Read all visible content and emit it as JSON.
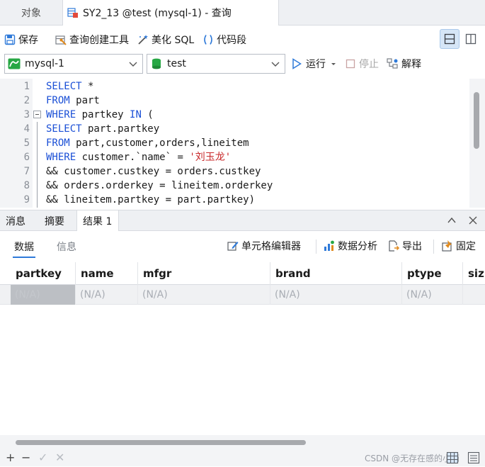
{
  "tabs": {
    "objects": "对象",
    "query": "SY2_13 @test (mysql-1) - 查询"
  },
  "toolbar": {
    "save": "保存",
    "query_builder": "查询创建工具",
    "beautify": "美化 SQL",
    "snippet": "代码段"
  },
  "connection": {
    "conn_value": "mysql-1",
    "db_value": "test",
    "run": "运行",
    "stop": "停止",
    "explain": "解释"
  },
  "editor": {
    "lines": [
      {
        "n": "1",
        "parts": [
          {
            "t": "SELECT",
            "c": "kw"
          },
          {
            "t": " *",
            "c": ""
          }
        ]
      },
      {
        "n": "2",
        "parts": [
          {
            "t": "FROM",
            "c": "kw"
          },
          {
            "t": " part",
            "c": ""
          }
        ]
      },
      {
        "n": "3",
        "parts": [
          {
            "t": "WHERE",
            "c": "kw"
          },
          {
            "t": " partkey ",
            "c": ""
          },
          {
            "t": "IN",
            "c": "kw"
          },
          {
            "t": " (",
            "c": ""
          }
        ]
      },
      {
        "n": "4",
        "parts": [
          {
            "t": "SELECT",
            "c": "kw"
          },
          {
            "t": " part.partkey",
            "c": ""
          }
        ]
      },
      {
        "n": "5",
        "parts": [
          {
            "t": "FROM",
            "c": "kw"
          },
          {
            "t": " part,customer,orders,lineitem",
            "c": ""
          }
        ]
      },
      {
        "n": "6",
        "parts": [
          {
            "t": "WHERE",
            "c": "kw"
          },
          {
            "t": " customer.`name` = ",
            "c": ""
          },
          {
            "t": "'刘玉龙'",
            "c": "str"
          }
        ]
      },
      {
        "n": "7",
        "parts": [
          {
            "t": "&& customer.custkey = orders.custkey",
            "c": ""
          }
        ]
      },
      {
        "n": "8",
        "parts": [
          {
            "t": "&& orders.orderkey = lineitem.orderkey",
            "c": ""
          }
        ]
      },
      {
        "n": "9",
        "parts": [
          {
            "t": "&& lineitem.partkey = part.partkey)",
            "c": ""
          }
        ]
      }
    ]
  },
  "result_tabs": {
    "messages": "消息",
    "summary": "摘要",
    "result1": "结果 1"
  },
  "result_sub": {
    "data": "数据",
    "info": "信息",
    "cell_editor": "单元格编辑器",
    "data_analysis": "数据分析",
    "export": "导出",
    "pin": "固定"
  },
  "grid": {
    "columns": [
      "partkey",
      "name",
      "mfgr",
      "brand",
      "ptype",
      "siz"
    ],
    "row": [
      "(N/A)",
      "(N/A)",
      "(N/A)",
      "(N/A)",
      "(N/A)",
      ""
    ]
  },
  "status": {
    "add": "+",
    "remove": "−",
    "apply": "✓",
    "discard": "✕",
    "watermark": "CSDN @无存在感的小雨"
  },
  "colors": {
    "keyword": "#1a4fd6",
    "string": "#c8282a",
    "accent": "#2f7ad9"
  }
}
